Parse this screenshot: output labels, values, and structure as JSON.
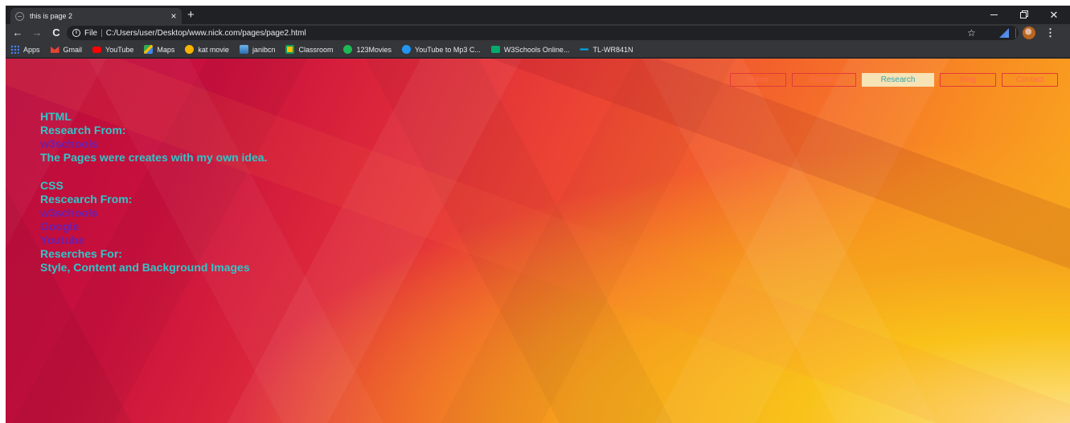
{
  "tab": {
    "title": "this is page 2"
  },
  "toolbar": {
    "scheme": "File",
    "url": "C:/Users/user/Desktop/www.nick.com/pages/page2.html"
  },
  "bookmarks": [
    {
      "label": "Apps",
      "icon": "apps-grid-icon"
    },
    {
      "label": "Gmail",
      "icon": "gmail-icon"
    },
    {
      "label": "YouTube",
      "icon": "youtube-icon"
    },
    {
      "label": "Maps",
      "icon": "maps-icon"
    },
    {
      "label": "kat movie",
      "icon": "kat-movie-icon"
    },
    {
      "label": "janibcn",
      "icon": "janibcn-icon"
    },
    {
      "label": "Classroom",
      "icon": "classroom-icon"
    },
    {
      "label": "123Movies",
      "icon": "123movies-icon"
    },
    {
      "label": "YouTube to Mp3 C...",
      "icon": "youtube-mp3-icon"
    },
    {
      "label": "W3Schools Online...",
      "icon": "w3schools-icon"
    },
    {
      "label": "TL-WR841N",
      "icon": "tp-link-icon"
    }
  ],
  "nav": {
    "items": [
      {
        "label": "Home"
      },
      {
        "label": "Resume"
      },
      {
        "label": "Research",
        "active": true
      },
      {
        "label": "Blog"
      },
      {
        "label": "Contact"
      }
    ]
  },
  "content": {
    "html_heading": "HTML",
    "html_research_from": "Research From:",
    "html_link_w3schools": "w3schools",
    "html_note": "The Pages were creates with my own idea.",
    "css_heading": "CSS",
    "css_research_from": "Rescearch From:",
    "css_link_w3schools": "w3schools",
    "css_link_google": "Google",
    "css_link_youtube": "Youtube",
    "css_researches_for": "Reserches For:",
    "css_topics": "Style, Content and Background Images"
  },
  "colors": {
    "heading_text": "#2fc7c9",
    "link_text": "#6a1fae",
    "nav_border": "#e23a3a",
    "nav_active_bg": "#f6e3b6"
  }
}
